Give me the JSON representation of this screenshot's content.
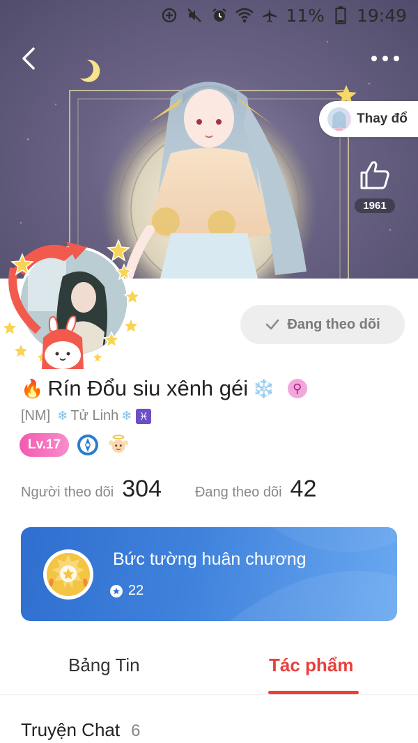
{
  "status_bar": {
    "battery": "11%",
    "time": "19:49",
    "icons": [
      "data-saver-icon",
      "mute-icon",
      "alarm-icon",
      "wifi-icon",
      "airplane-icon",
      "battery-icon"
    ]
  },
  "header": {
    "change_label": "Thay đổ",
    "likes": "1961"
  },
  "profile": {
    "follow_button": "Đang theo dõi",
    "fire": "🔥",
    "name": "Rín Đổu siu xênh géi",
    "snowflake": "❄️",
    "gender_symbol": "⚲",
    "tag": "[NM]",
    "sub_flake_left": "❄",
    "sub_name": "Tử Linh",
    "sub_flake_right": "❄",
    "zodiac": "♓",
    "level": "Lv.17"
  },
  "stats": {
    "followers_label": "Người theo dõi",
    "followers_value": "304",
    "following_label": "Đang theo dõi",
    "following_value": "42"
  },
  "medal_wall": {
    "title": "Bức tường huân chương",
    "count": "22"
  },
  "tabs": {
    "feed": "Bảng Tin",
    "works": "Tác phẩm"
  },
  "section": {
    "title": "Truyện Chat",
    "count": "6"
  },
  "colors": {
    "accent_red": "#e8403d",
    "level_pink": "#f25ab0",
    "medal_blue": "#2f6fcf"
  }
}
